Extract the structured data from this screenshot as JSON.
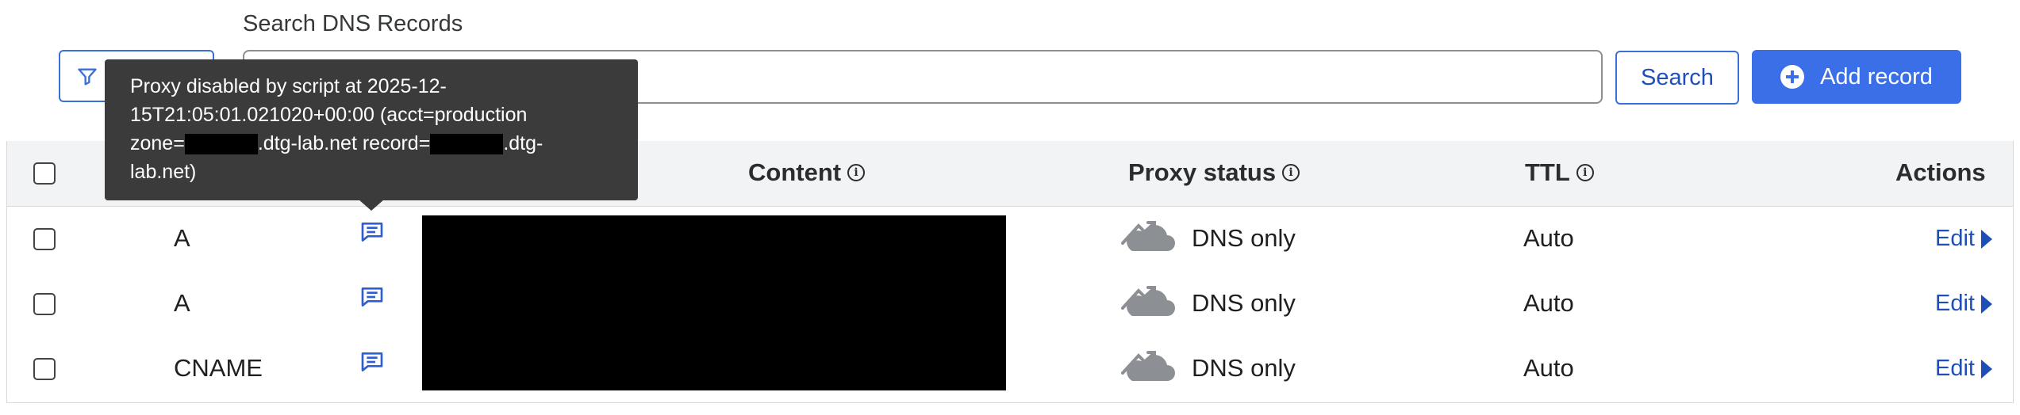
{
  "search": {
    "label": "Search DNS Records",
    "input_value": "",
    "button_label": "Search"
  },
  "toolbar": {
    "add_record_label": "Add record"
  },
  "tooltip": {
    "line1": "Proxy disabled by script at 2025-12-",
    "line2": "15T21:05:01.021020+00:00 (acct=production",
    "line3_a": "zone=",
    "line3_b": ".dtg-lab.net record=",
    "line3_c": ".dtg-",
    "line4": "lab.net)"
  },
  "table": {
    "headers": {
      "content": "Content",
      "proxy_status": "Proxy status",
      "ttl": "TTL",
      "actions": "Actions"
    },
    "rows": [
      {
        "type": "A",
        "proxy_status": "DNS only",
        "ttl": "Auto",
        "action": "Edit"
      },
      {
        "type": "A",
        "proxy_status": "DNS only",
        "ttl": "Auto",
        "action": "Edit"
      },
      {
        "type": "CNAME",
        "proxy_status": "DNS only",
        "ttl": "Auto",
        "action": "Edit"
      }
    ]
  },
  "icons": {
    "filter": "filter-icon",
    "add": "plus-circle-icon",
    "info": "info-icon",
    "comment": "comment-icon",
    "proxy": "cloud-off-icon",
    "edit_arrow": "caret-right-icon"
  },
  "colors": {
    "accent": "#3b6fe8",
    "link": "#1e4fb8",
    "tooltip_bg": "#3b3b3b",
    "header_bg": "#f2f3f4"
  }
}
